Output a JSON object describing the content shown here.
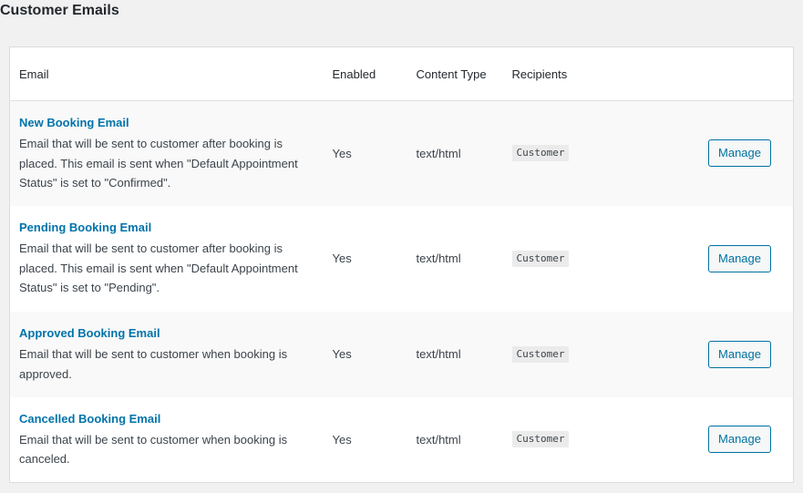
{
  "page": {
    "title": "Customer Emails"
  },
  "table": {
    "headers": {
      "email": "Email",
      "enabled": "Enabled",
      "content_type": "Content Type",
      "recipients": "Recipients"
    },
    "rows": [
      {
        "title": "New Booking Email",
        "description": "Email that will be sent to customer after booking is placed. This email is sent when \"Default Appointment Status\" is set to \"Confirmed\".",
        "enabled": "Yes",
        "content_type": "text/html",
        "recipient": "Customer",
        "action": "Manage"
      },
      {
        "title": "Pending Booking Email",
        "description": "Email that will be sent to customer after booking is placed. This email is sent when \"Default Appointment Status\" is set to \"Pending\".",
        "enabled": "Yes",
        "content_type": "text/html",
        "recipient": "Customer",
        "action": "Manage"
      },
      {
        "title": "Approved Booking Email",
        "description": "Email that will be sent to customer when booking is approved.",
        "enabled": "Yes",
        "content_type": "text/html",
        "recipient": "Customer",
        "action": "Manage"
      },
      {
        "title": "Cancelled Booking Email",
        "description": "Email that will be sent to customer when booking is canceled.",
        "enabled": "Yes",
        "content_type": "text/html",
        "recipient": "Customer",
        "action": "Manage"
      }
    ]
  },
  "colors": {
    "link": "#0073aa",
    "button_accent": "#0071a1",
    "background": "#f1f1f1"
  }
}
